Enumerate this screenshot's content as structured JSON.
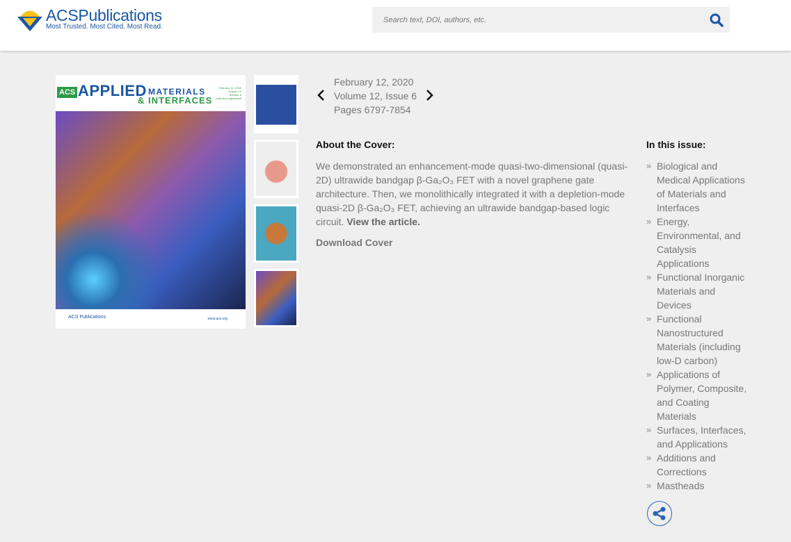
{
  "header": {
    "logo_title_bold": "ACS",
    "logo_title": "Publications",
    "logo_tagline": "Most Trusted. Most Cited. Most Read.",
    "search_placeholder": "Search text, DOI, authors, etc."
  },
  "cover": {
    "acs": "ACS",
    "applied": "APPLIED",
    "materials": "MATERIALS",
    "interfaces": "& INTERFACES",
    "meta": [
      "February 12, 2020",
      "Volume 12",
      "Number 6",
      "pubs.acs.org/acsami"
    ],
    "footer_logo": "ACS Publications",
    "footer_url": "www.acs.org"
  },
  "issue_nav": {
    "date": "February 12, 2020",
    "volume": "Volume 12, Issue 6",
    "pages": "Pages 6797-7854"
  },
  "about": {
    "heading": "About the Cover:",
    "text": "We demonstrated an enhancement-mode quasi-two-dimensional (quasi-2D) ultrawide bandgap β-Ga₂O₃ FET with a novel graphene gate architecture. Then, we monolithically integrated it with a depletion-mode quasi-2D β-Ga₂O₃ FET, achieving an ultrawide bandgap-based logic circuit.",
    "link": "View the article.",
    "download": "Download Cover"
  },
  "in_this_issue": {
    "heading": "In this issue:",
    "items": [
      "Biological and Medical Applications of Materials and Interfaces",
      "Energy, Environmental, and Catalysis Applications",
      "Functional Inorganic Materials and Devices",
      "Functional Nanostructured Materials (including low-D carbon)",
      "Applications of Polymer, Composite, and Coating Materials",
      "Surfaces, Interfaces, and Applications",
      "Additions and Corrections",
      "Mastheads"
    ]
  },
  "colors": {
    "brand_blue": "#1a56a4",
    "acs_green": "#2e9a48",
    "share_blue": "#2a62b8"
  }
}
